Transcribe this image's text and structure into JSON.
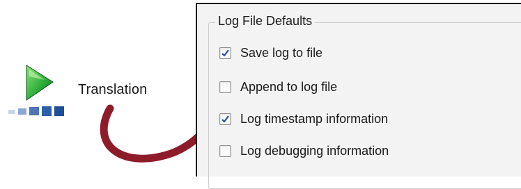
{
  "app_node": {
    "label": "Translation",
    "icon": "play-arrow-icon"
  },
  "panel": {
    "group_title": "Log File Defaults",
    "options": [
      {
        "label": "Save log to file",
        "checked": true
      },
      {
        "label": "Append to log file",
        "checked": false
      },
      {
        "label": "Log timestamp information",
        "checked": true
      },
      {
        "label": "Log debugging information",
        "checked": false
      }
    ]
  },
  "colors": {
    "arrow": "#8e1b2a",
    "icon_green": "#2fae3a",
    "icon_blue": "#2b5fa8",
    "checkmark": "#2a4fa0"
  }
}
